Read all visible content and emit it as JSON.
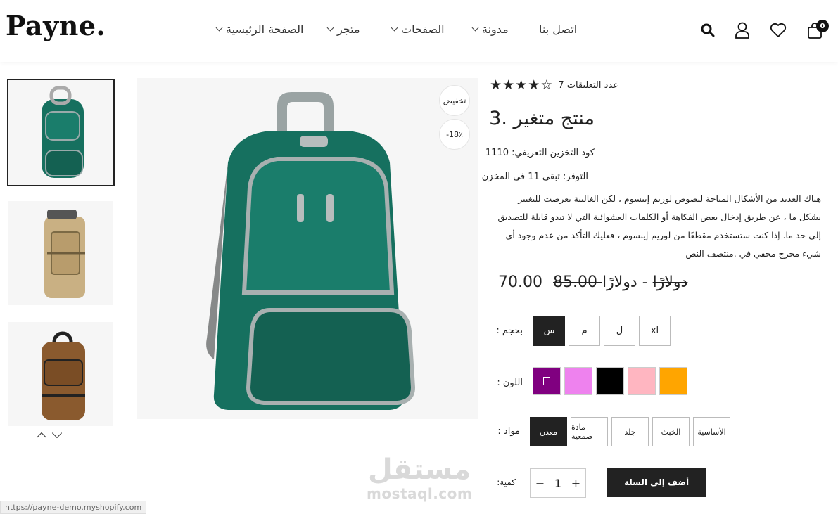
{
  "header": {
    "logo": "Payne.",
    "nav": [
      "الصفحة الرئيسية",
      "متجر",
      "الصفحات",
      "مدونة",
      "اتصل بنا"
    ],
    "cart_count": "0",
    "icons": [
      "search-icon",
      "user-icon",
      "heart-icon",
      "bag-icon"
    ]
  },
  "gallery": {
    "badge_sale": "تخفيض",
    "badge_discount": "-18٪"
  },
  "product": {
    "rating_text": "عدد التعليقات 7",
    "rating_stars": 4,
    "title": "منتج متغير .3",
    "sku": "كود التخزين التعريفي: 1110",
    "availability": "التوفر: تبقى 11 في المخزن",
    "description": "هناك العديد من الأشكال المتاحة لنصوص لوريم إيبسوم ، لكن الغالبية تعرضت للتغيير بشكل ما ، عن طريق إدخال بعض الفكاهة أو الكلمات العشوائية التي لا تبدو قابلة للتصديق إلى حد ما. إذا كنت ستستخدم مقطعًا من لوريم إيبسوم ، فعليك التأكد من عدم وجود أي شيء محرج مخفي في .منتصف النص",
    "price_new": "70.00",
    "price_old": "85.00 دولارًا",
    "price_sep": "-",
    "price_currency": "دولارًا",
    "size_label": "بحجم :",
    "sizes": [
      "س",
      "م",
      "ل",
      "xl"
    ],
    "color_label": "اللون :",
    "colors": [
      "#800080",
      "#ee82ee",
      "#000000",
      "#ffb6c1",
      "#ffa500"
    ],
    "material_label": "مواد :",
    "materials": [
      "معدن",
      "مادة صمغية",
      "جلد",
      "الخبث",
      "الأساسية"
    ],
    "quantity_label": "كمية:",
    "quantity": "1",
    "qty_minus": "−",
    "qty_plus": "+",
    "add_to_cart": "أضف إلى السلة"
  },
  "status_url": "https://payne-demo.myshopify.com",
  "watermark": {
    "arabic": "مستقل",
    "latin": "mostaql.com"
  }
}
